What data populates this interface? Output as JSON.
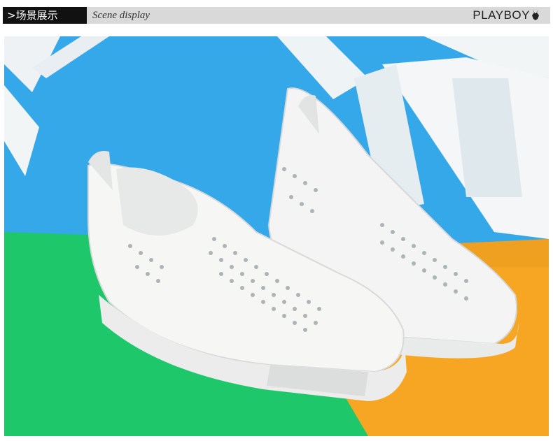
{
  "header": {
    "prefix": ">",
    "title_cn": "场景展示",
    "title_en": "Scene display",
    "brand": "PLAYBOY"
  },
  "photo": {
    "subject": "shoes-photo",
    "colors": {
      "blue": "#35a8ea",
      "green": "#1ec86a",
      "orange": "#f6a623",
      "white": "#f3f4f3"
    }
  }
}
